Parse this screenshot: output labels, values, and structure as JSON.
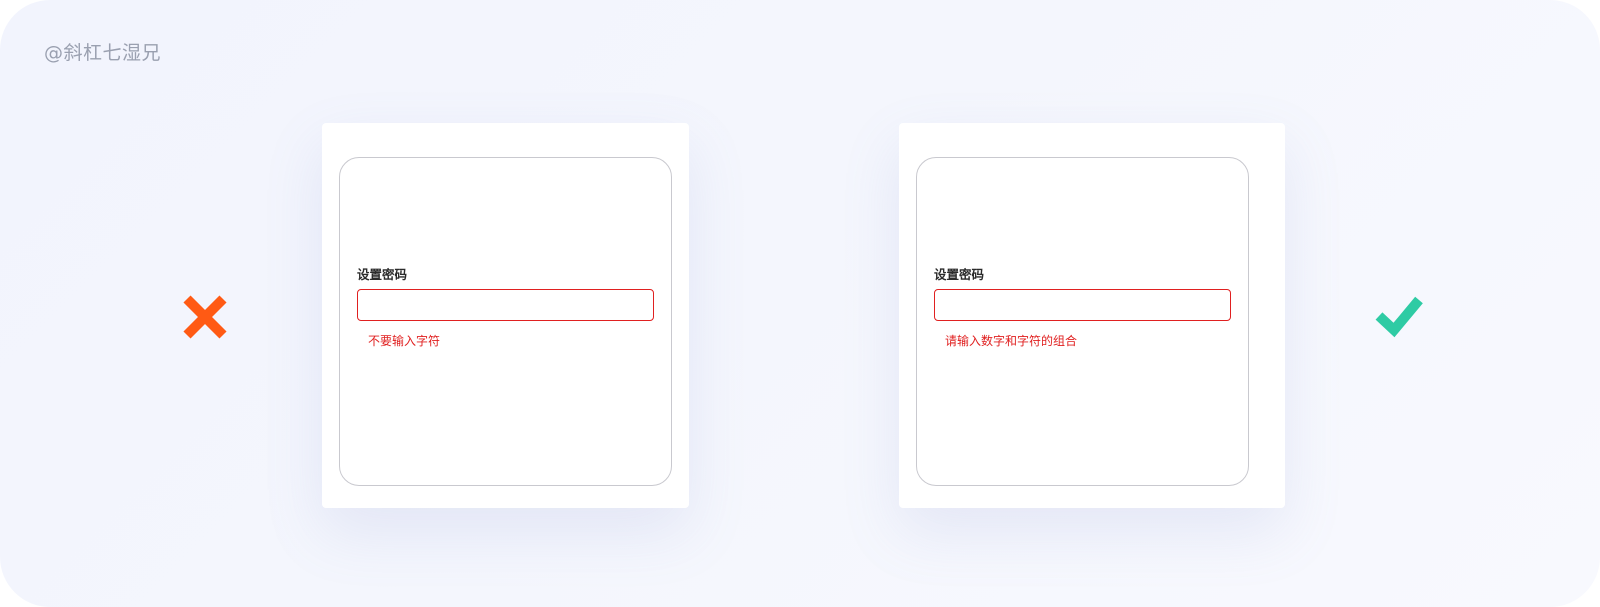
{
  "watermark": "@斜杠七湿兄",
  "examples": {
    "bad": {
      "verdict_icon": "cross-icon",
      "verdict_color": "#ff5a14",
      "field_label": "设置密码",
      "input_value": "",
      "error_message": "不要输入字符"
    },
    "good": {
      "verdict_icon": "check-icon",
      "verdict_color": "#2ecba4",
      "field_label": "设置密码",
      "input_value": "",
      "error_message": "请输入数字和字符的组合"
    }
  },
  "colors": {
    "error": "#e02020",
    "background": "#f4f6fd"
  }
}
